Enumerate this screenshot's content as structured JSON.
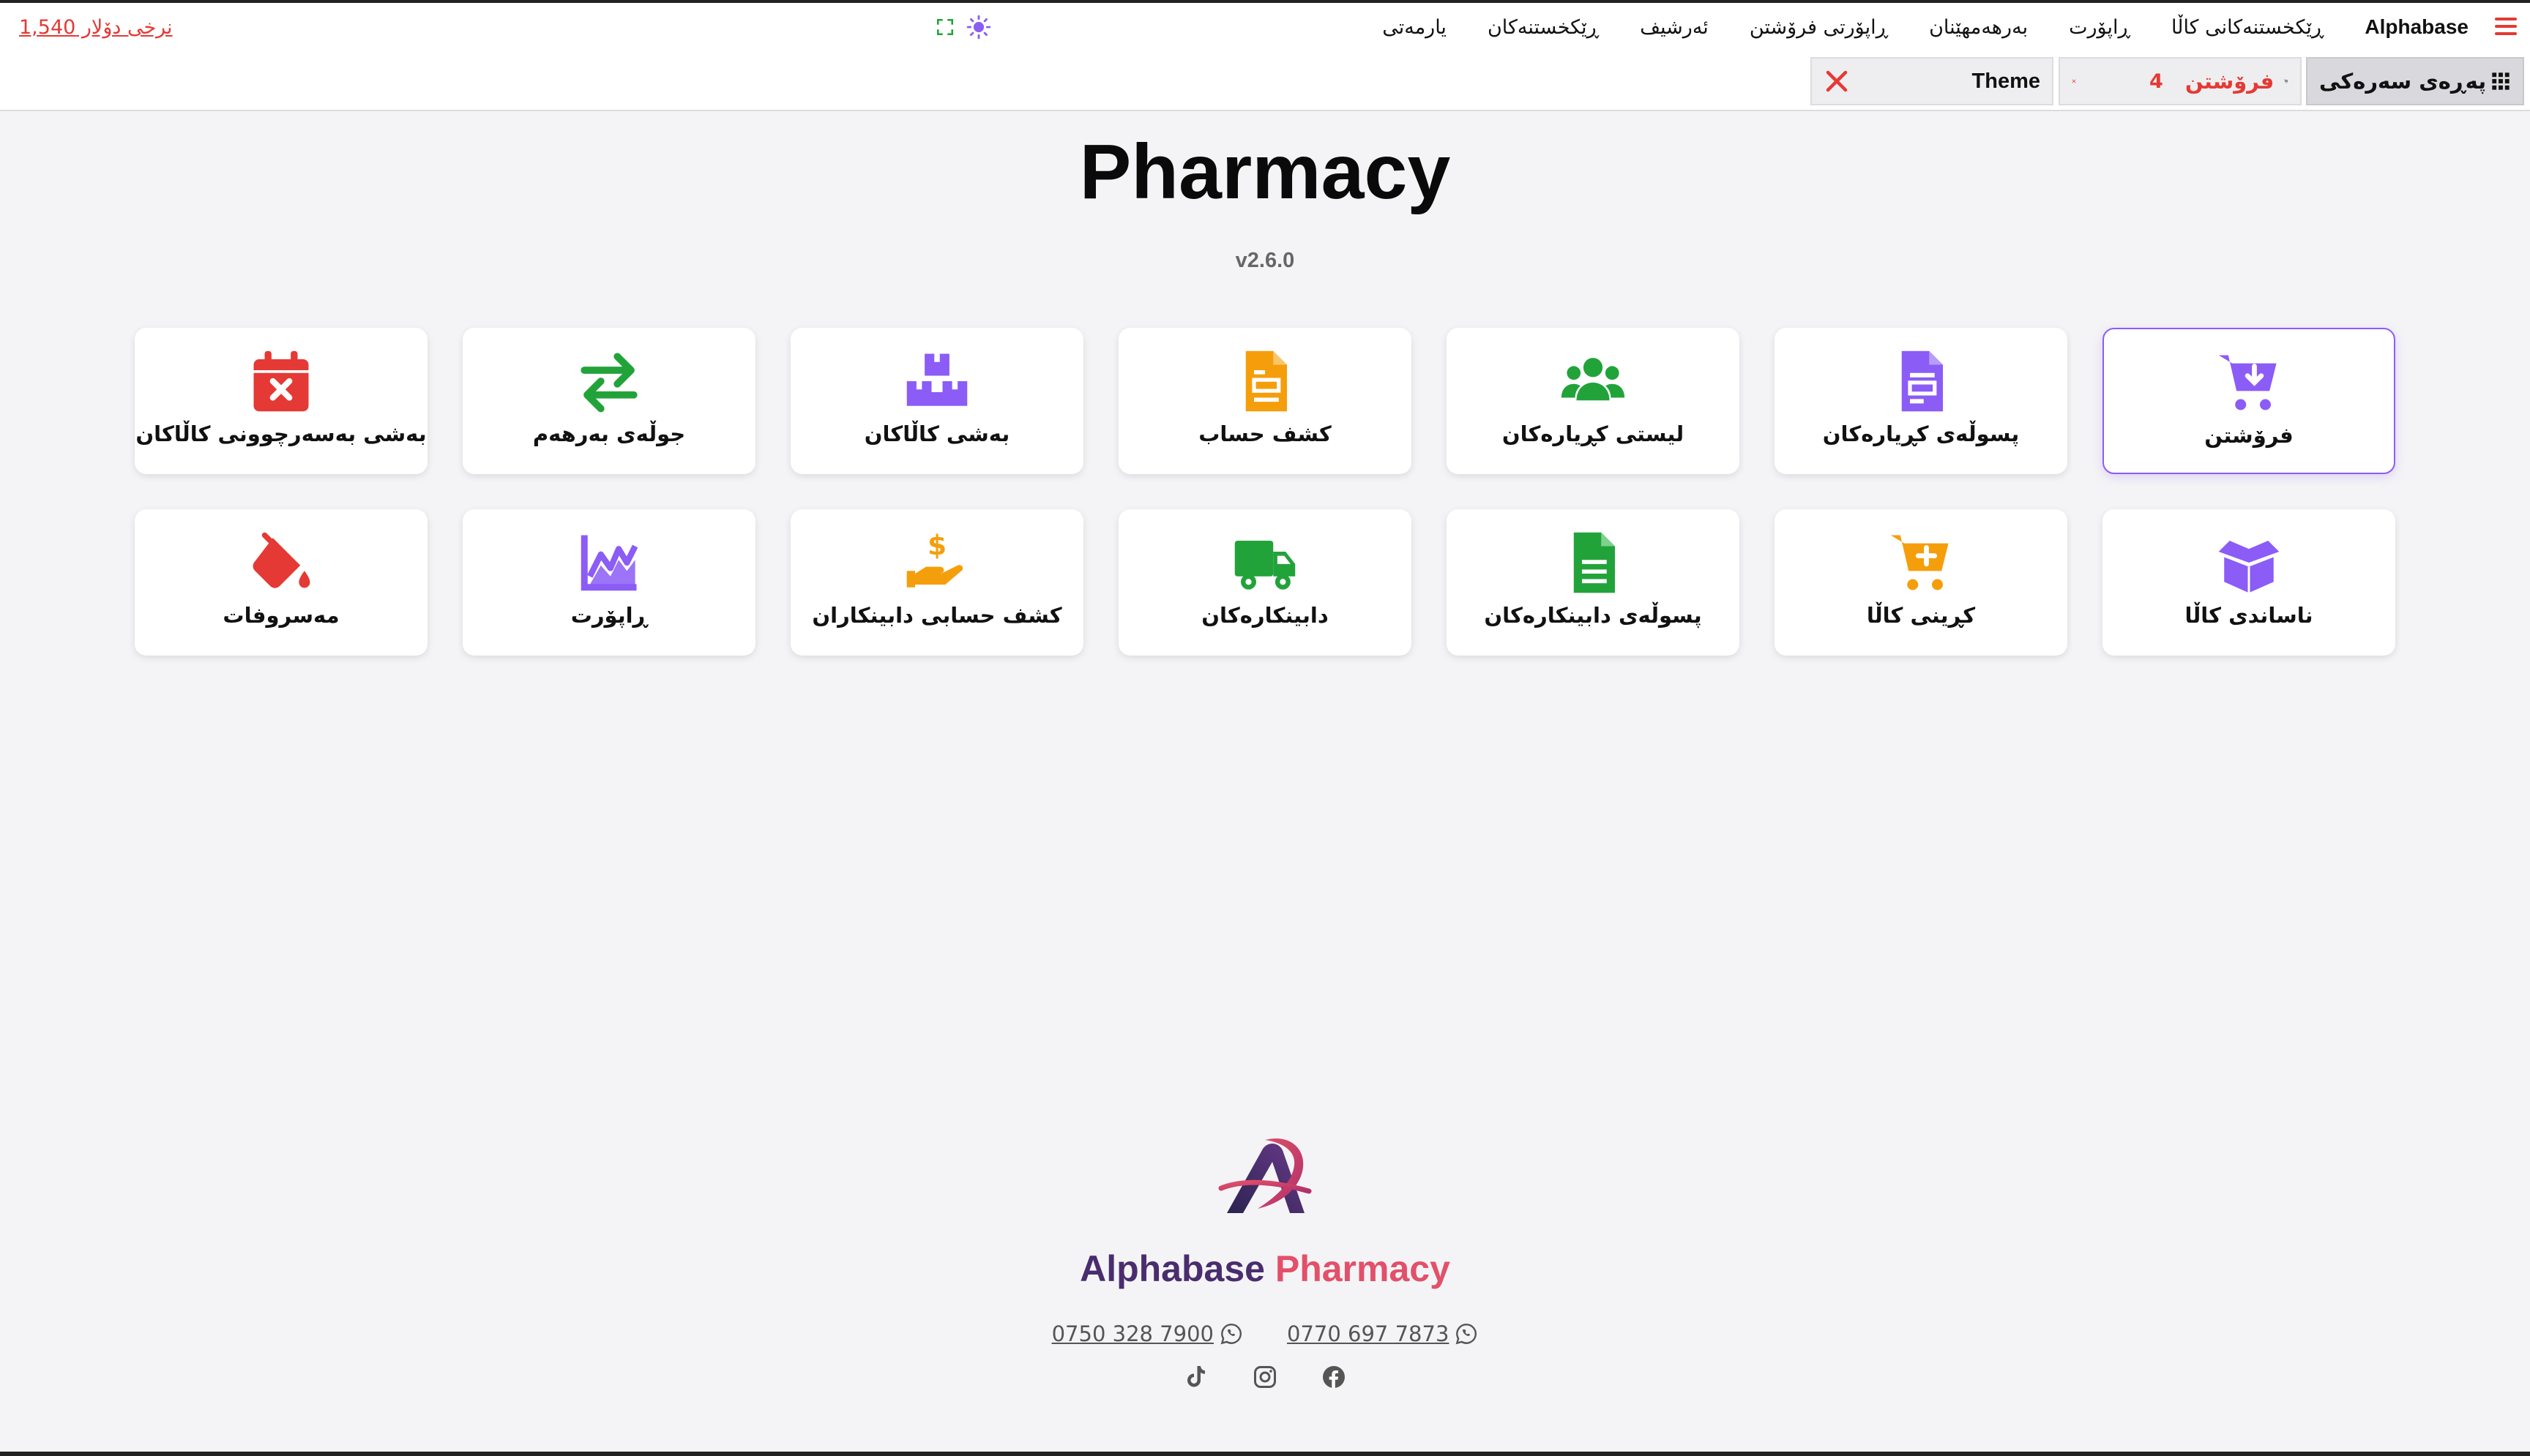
{
  "topnav": {
    "brand": "Alphabase",
    "links": [
      "ڕێکخستنەکانی کاڵا",
      "ڕاپۆرت",
      "بەرهەمهێنان",
      "ڕاپۆرتی فرۆشتن",
      "ئەرشیف",
      "ڕێکخستنەکان",
      "یارمەتی"
    ],
    "dollar_rate": "نرخی دۆلار 1,540"
  },
  "tabs": {
    "home_label": "پەڕەی سەرەکی",
    "sales_label": "فرۆشتن",
    "sales_count": "4",
    "theme_label": "Theme"
  },
  "title": "Pharmacy",
  "version": "v2.6.0",
  "cards": [
    {
      "label": "فرۆشتن",
      "icon": "cart-download-icon"
    },
    {
      "label": "پسوڵەی کڕیارەکان",
      "icon": "invoice-icon"
    },
    {
      "label": "لیستی کڕیارەکان",
      "icon": "users-icon"
    },
    {
      "label": "کشف حساب",
      "icon": "statement-icon"
    },
    {
      "label": "بەشی کاڵاکان",
      "icon": "boxes-icon"
    },
    {
      "label": "جوڵەی بەرهەم",
      "icon": "transfer-arrows-icon"
    },
    {
      "label": "بەشی بەسەرچوونی کاڵاکان",
      "icon": "calendar-expired-icon"
    },
    {
      "label": "ناساندی کاڵا",
      "icon": "open-box-icon"
    },
    {
      "label": "کڕینی کاڵا",
      "icon": "cart-plus-icon"
    },
    {
      "label": "پسوڵەی دابینکارەکان",
      "icon": "document-icon"
    },
    {
      "label": "دابینکارەکان",
      "icon": "truck-icon"
    },
    {
      "label": "کشف حسابی دابینکاران",
      "icon": "hand-dollar-icon"
    },
    {
      "label": "ڕاپۆرت",
      "icon": "chart-line-icon"
    },
    {
      "label": "مەسروفات",
      "icon": "paint-bucket-icon"
    }
  ],
  "colors": {
    "accent": "#8b5cf6",
    "danger": "#e53935",
    "green": "#22a33a",
    "orange": "#f59e0b"
  },
  "footer": {
    "brand_part1": "Alphabase",
    "brand_part2": "Pharmacy",
    "phone1": "0770 697 7873",
    "phone2": "0750 328 7900",
    "socials": [
      "facebook-icon",
      "instagram-icon",
      "tiktok-icon"
    ]
  }
}
